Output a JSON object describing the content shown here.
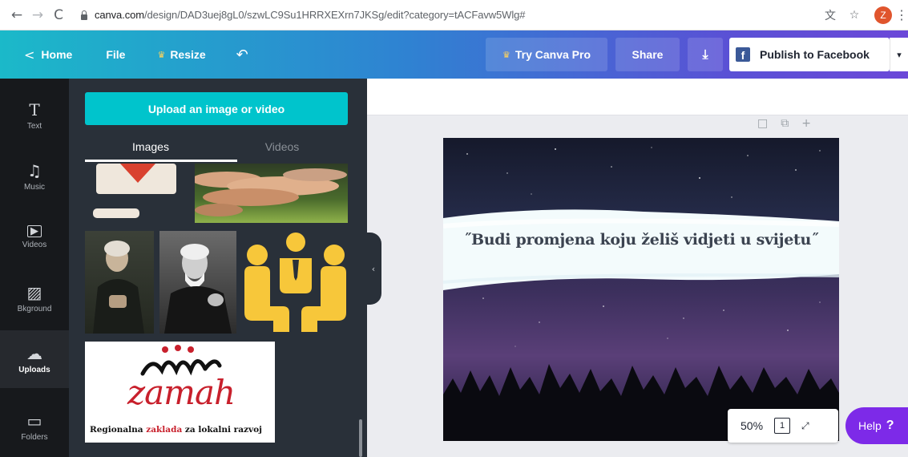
{
  "browser": {
    "back_icon": "←",
    "forward_icon": "→",
    "reload_icon": "C",
    "url_host": "canva.com",
    "url_path": "/design/DAD3uej8gL0/szwLC9Su1HRRXEXrn7JKSg/edit?category=tACFavw5Wlg#",
    "translate_icon": "文",
    "star_icon": "☆",
    "profile_initial": "Z",
    "menu_icon": "⋮"
  },
  "topbar": {
    "home_chevron": "<",
    "home_label": "Home",
    "file_label": "File",
    "resize_crown": "♛",
    "resize_label": "Resize",
    "undo_icon": "↶",
    "pro_crown": "♛",
    "pro_label": "Try Canva Pro",
    "share_label": "Share",
    "download_icon": "⤓",
    "facebook_logo": "f",
    "publish_label": "Publish to Facebook",
    "publish_dropdown_icon": "▾"
  },
  "rail": {
    "items": [
      {
        "icon": "T",
        "label": "Text"
      },
      {
        "icon": "♫",
        "label": "Music"
      },
      {
        "icon": "▶",
        "label": "Videos"
      },
      {
        "icon": "▨",
        "label": "Bkground"
      },
      {
        "icon": "☁",
        "label": "Uploads"
      },
      {
        "icon": "▭",
        "label": "Folders"
      }
    ]
  },
  "panel": {
    "upload_label": "Upload an image or video",
    "tab_images": "Images",
    "tab_videos": "Videos",
    "zamah_name": "zamah",
    "zamah_sub_1": "Regionalna",
    "zamah_sub_2": "zaklada",
    "zamah_sub_3": "za lokalni razvoj"
  },
  "canvas": {
    "collapse_icon": "‹",
    "page_tool_notes": "□",
    "page_tool_copy": "⧉",
    "page_tool_add": "+",
    "quote": "˝Budi promjena koju želiš vidjeti u svijetu˝"
  },
  "footer": {
    "zoom_level": "50%",
    "page_count": "1",
    "expand_icon": "⤢",
    "help_label": "Help",
    "help_mark": "?"
  },
  "colors": {
    "accent_teal": "#00c4cc",
    "panel_bg": "#293039",
    "rail_bg": "#17191c",
    "help_purple": "#7d2ae8",
    "facebook_blue": "#3b5998"
  }
}
